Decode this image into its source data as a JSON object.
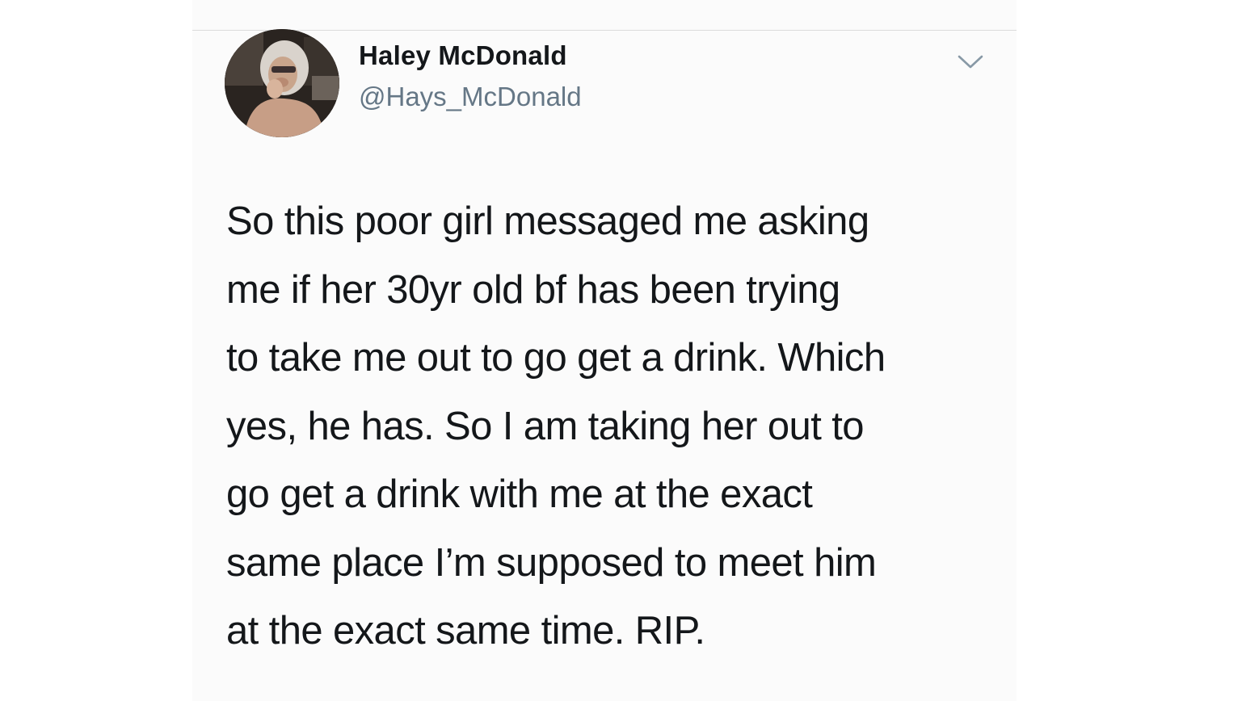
{
  "tweet": {
    "author": {
      "display_name": "Haley McDonald",
      "handle": "@Hays_McDonald"
    },
    "text_lines": [
      "So this poor girl messaged me asking",
      "me if her 30yr old bf has been trying",
      "to take me out to go get a drink. Which",
      "yes, he has. So I am taking her out to",
      "go get a drink with me at the exact",
      "same place I’m supposed to meet him",
      "at the exact same time. RIP."
    ],
    "menu_icon": "chevron-down-icon"
  },
  "colors": {
    "text_primary": "#14171a",
    "text_secondary": "#657786",
    "card_background": "#fbfbfb",
    "divider": "#dcdcdc"
  }
}
